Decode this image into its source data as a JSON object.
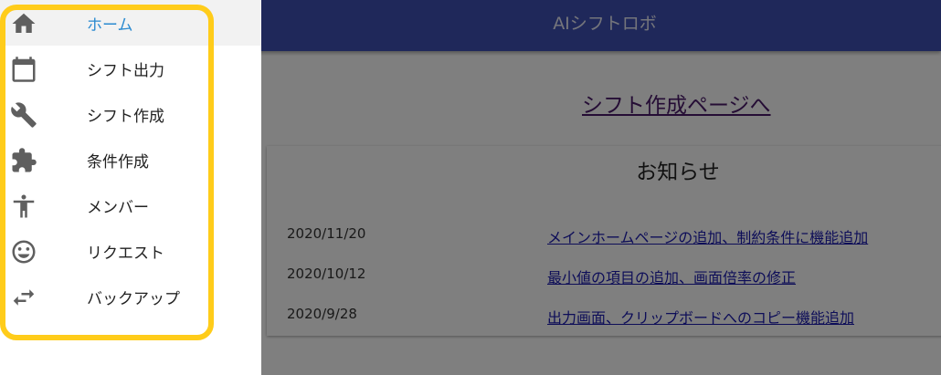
{
  "app_bar": {
    "title": "AIシフトロボ"
  },
  "main": {
    "shift_page_link": "シフト作成ページへ",
    "news": {
      "title": "お知らせ",
      "items": [
        {
          "date": "2020/11/20",
          "text": "メインホームページの追加、制約条件に機能追加"
        },
        {
          "date": "2020/10/12",
          "text": "最小値の項目の追加、画面倍率の修正"
        },
        {
          "date": "2020/9/28",
          "text": "出力画面、クリップボードへのコピー機能追加"
        }
      ]
    }
  },
  "drawer": {
    "items": [
      {
        "label": "ホーム",
        "icon": "home-icon",
        "active": true
      },
      {
        "label": "シフト出力",
        "icon": "calendar-icon"
      },
      {
        "label": "シフト作成",
        "icon": "wrench-icon"
      },
      {
        "label": "条件作成",
        "icon": "puzzle-icon"
      },
      {
        "label": "メンバー",
        "icon": "person-icon"
      },
      {
        "label": "リクエスト",
        "icon": "smiley-icon"
      },
      {
        "label": "バックアップ",
        "icon": "swap-icon"
      }
    ],
    "colors": {
      "active_label": "#2a8ad0",
      "icon": "#5f5f5f",
      "highlight_border": "#ffcc1a"
    }
  },
  "colors": {
    "app_bar": "#3f51b5",
    "link": "#1a1ab0",
    "visited_link": "#4a1a6a",
    "scrim": "rgba(0,0,0,0.5)"
  }
}
